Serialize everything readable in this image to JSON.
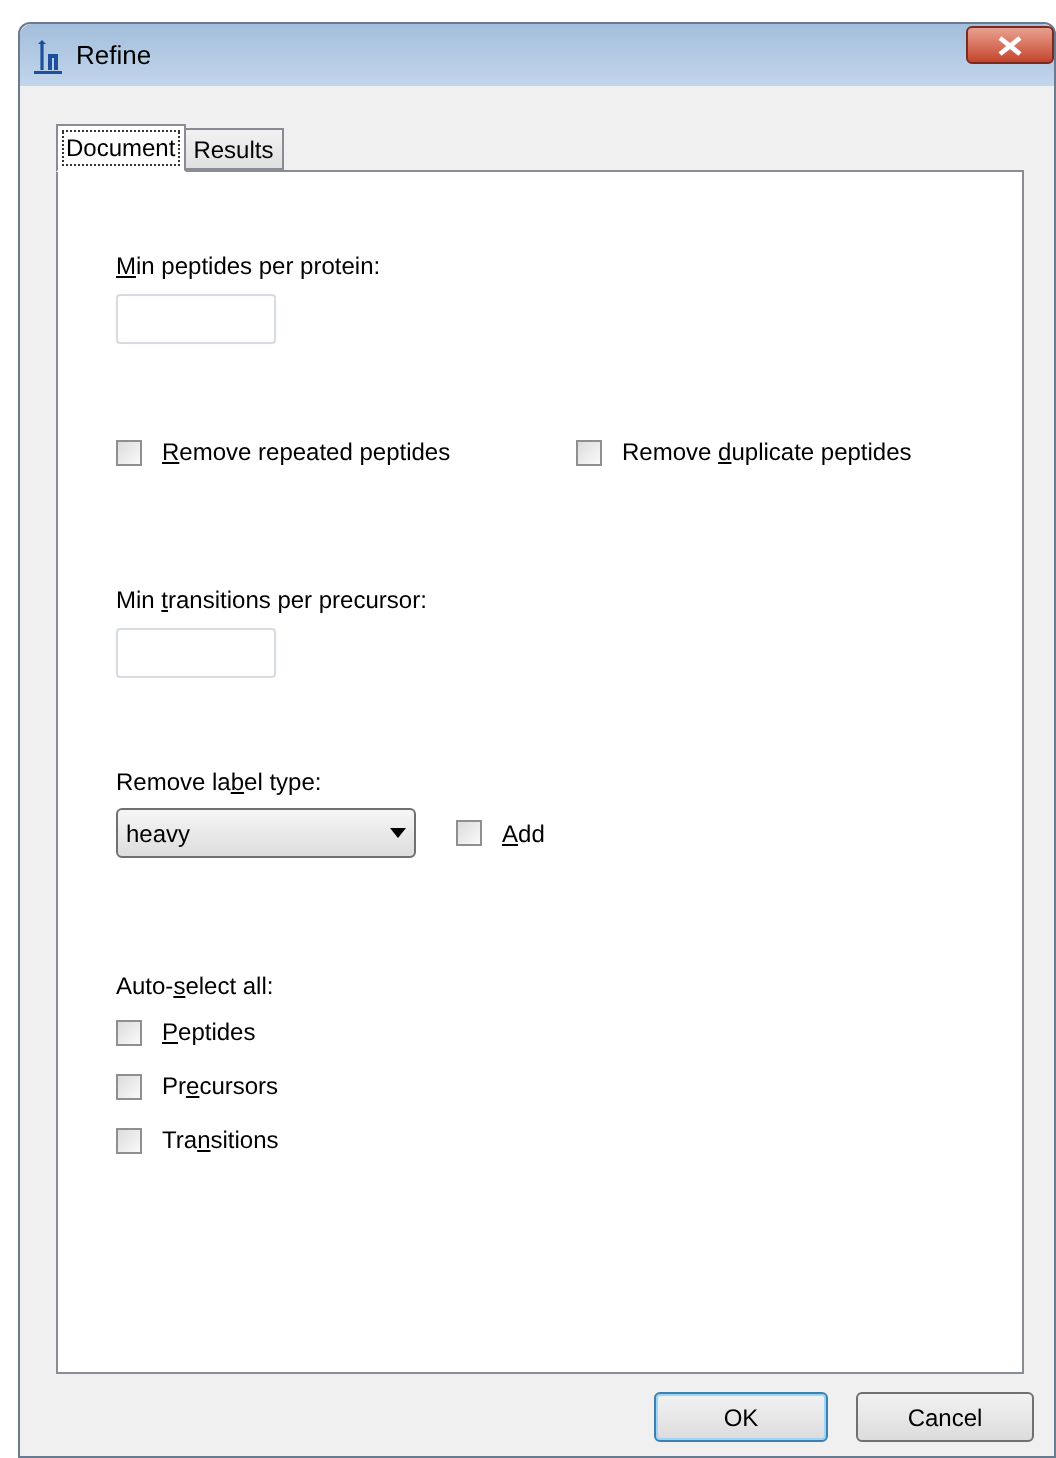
{
  "window": {
    "title": "Refine"
  },
  "tabs": [
    {
      "label": "Document",
      "selected": true
    },
    {
      "label": "Results",
      "selected": false
    }
  ],
  "min_peptides": {
    "access_key": "M",
    "label_end": "in peptides per protein:"
  },
  "remove_options": [
    {
      "access_key": "R",
      "label_end": "emove repeated peptides",
      "checked": false
    },
    {
      "label_start": "Remove ",
      "access_key": "d",
      "label_end": "uplicate peptides",
      "checked": false
    }
  ],
  "min_transitions": {
    "label_start": "Min ",
    "access_key": "t",
    "label_end": "ransitions per precursor:"
  },
  "remove_label_type": {
    "label_start": "Remove la",
    "access_key": "b",
    "label_end": "el type:",
    "value": "heavy",
    "add": {
      "access_key": "A",
      "label_end": "dd",
      "checked": false
    }
  },
  "auto_select": {
    "label_start": "Auto-",
    "access_key": "s",
    "label_end": "elect all:",
    "options": [
      {
        "access_key": "P",
        "label_end": "eptides",
        "checked": false
      },
      {
        "label_start": "Pr",
        "access_key": "e",
        "label_end": "cursors",
        "checked": false
      },
      {
        "label_start": "Tra",
        "access_key": "n",
        "label_end": "sitions",
        "checked": false
      }
    ]
  },
  "buttons": [
    {
      "label": "OK",
      "default": true
    },
    {
      "label": "Cancel",
      "default": false
    }
  ]
}
